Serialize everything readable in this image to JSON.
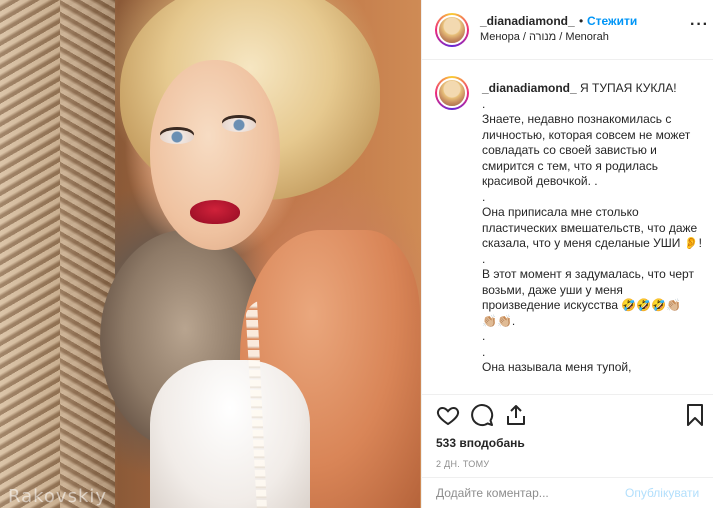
{
  "photo": {
    "watermark": "Rakovskiy"
  },
  "header": {
    "username": "_dianadiamond_",
    "dot": "•",
    "follow_label": "Стежити",
    "location": "Менора / מנורה / Menorah",
    "more_icon": "more-dots-icon",
    "more_label": "···"
  },
  "caption": {
    "username": "_dianadiamond_",
    "lead": " Я ТУПАЯ КУКЛА!",
    "body": ".\nЗнаете, недавно познакомилась с личностью, которая совсем не может совладать со своей завистью и смирится с тем, что я родилась красивой девочкой. .\n.\nОна приписала мне столько пластических вмешательств, что даже сказала, что у меня сделаные УШИ 👂!\n.\nВ этот момент я задумалась, что черт возьми, даже уши у меня произведение искусства 🤣🤣🤣👏🏼\n👏🏼👏🏼.\n.\n.\nОна называла меня тупой,"
  },
  "actions": {
    "like_icon": "heart-icon",
    "comment_icon": "comment-icon",
    "share_icon": "share-icon",
    "save_icon": "bookmark-icon",
    "likes": "533 вподобань",
    "time": "2 ДН. ТОМУ"
  },
  "comment": {
    "placeholder": "Додайте коментар...",
    "post_label": "Опублікувати"
  },
  "colors": {
    "accent": "#0095f6",
    "post_disabled": "#b2dffc",
    "muted": "#8e8e8e",
    "text": "#262626"
  }
}
